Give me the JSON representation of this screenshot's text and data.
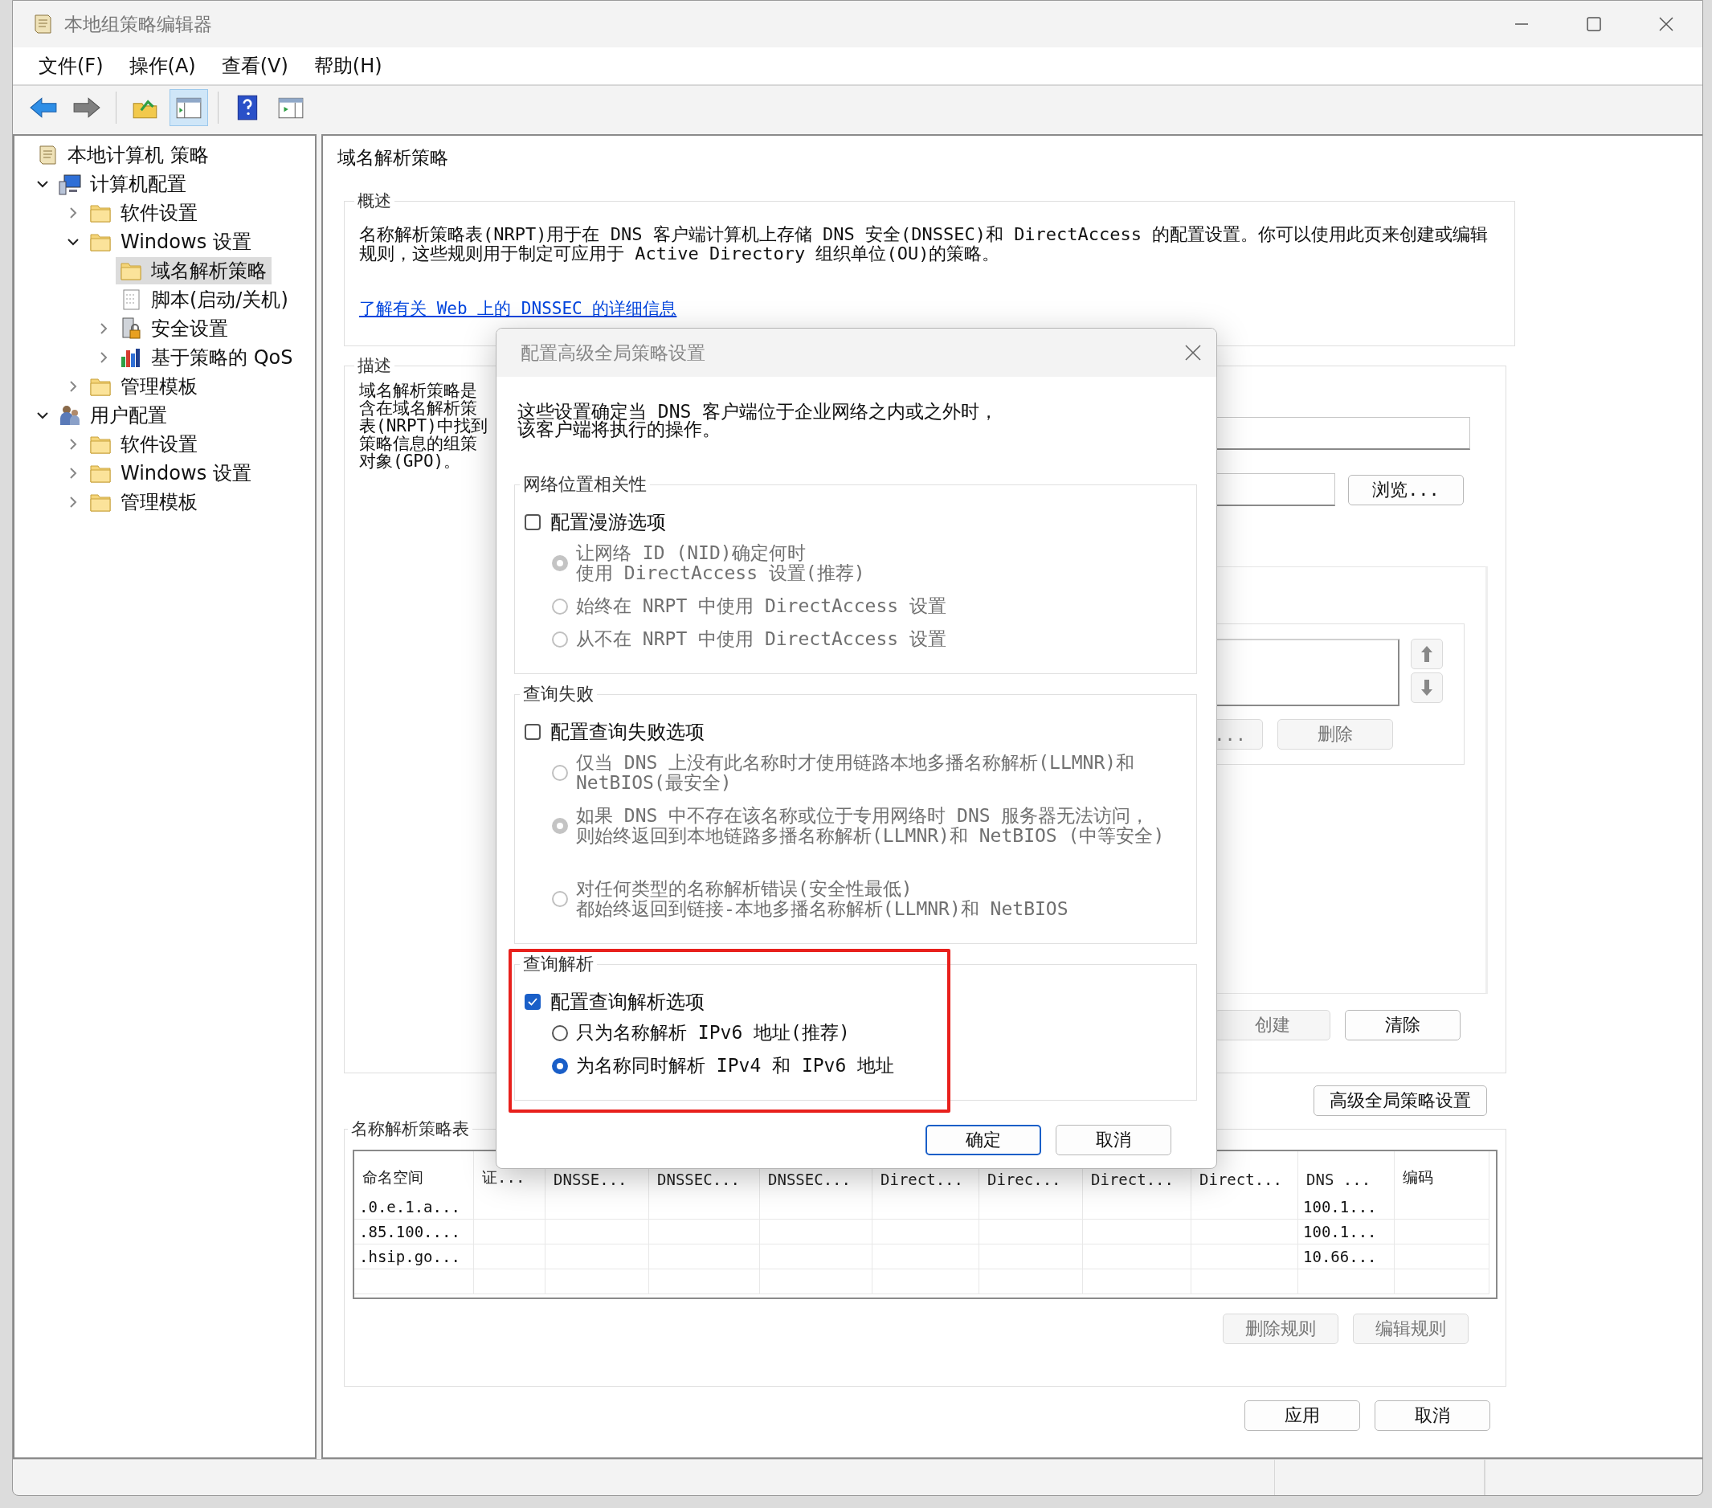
{
  "window": {
    "title": "本地组策略编辑器"
  },
  "menu": [
    "文件(F)",
    "操作(A)",
    "查看(V)",
    "帮助(H)"
  ],
  "toolbar": [
    {
      "kind": "back",
      "pressed": false
    },
    {
      "kind": "forward",
      "pressed": false
    },
    {
      "kind": "up",
      "pressed": false
    },
    {
      "kind": "tree",
      "pressed": true
    },
    {
      "kind": "help",
      "pressed": false
    },
    {
      "kind": "pane",
      "pressed": false
    }
  ],
  "tree": [
    {
      "label": "本地计算机 策略",
      "kind": "policy",
      "selected": false,
      "children": [
        {
          "label": "计算机配置",
          "kind": "computer",
          "selected": false,
          "expanded": true,
          "children": [
            {
              "label": "软件设置",
              "kind": "folder",
              "selected": false,
              "expanded": false
            },
            {
              "label": "Windows 设置",
              "kind": "folder",
              "selected": false,
              "expanded": true,
              "children": [
                {
                  "label": "域名解析策略",
                  "kind": "folder",
                  "selected": true
                },
                {
                  "label": "脚本(启动/关机)",
                  "kind": "script",
                  "selected": false
                },
                {
                  "label": "安全设置",
                  "kind": "security",
                  "selected": false,
                  "expanded": false
                },
                {
                  "label": "基于策略的 QoS",
                  "kind": "qos",
                  "selected": false,
                  "expanded": false
                }
              ]
            },
            {
              "label": "管理模板",
              "kind": "folder",
              "selected": false,
              "expanded": false
            }
          ]
        },
        {
          "label": "用户配置",
          "kind": "users",
          "selected": false,
          "expanded": true,
          "children": [
            {
              "label": "软件设置",
              "kind": "folder",
              "selected": false,
              "expanded": false
            },
            {
              "label": "Windows 设置",
              "kind": "folder",
              "selected": false,
              "expanded": false
            },
            {
              "label": "管理模板",
              "kind": "folder",
              "selected": false,
              "expanded": false
            }
          ]
        }
      ]
    }
  ],
  "page": {
    "title": "域名解析策略",
    "overview": {
      "title": "概述",
      "text": "名称解析策略表(NRPT)用于在 DNS 客户端计算机上存储 DNS 安全(DNSSEC)和 DirectAccess 的配置设置。你可以使用此页来创建或编辑规则，这些规则用于制定可应用于 Active Directory 组织单位(OU)的策略。",
      "link": "了解有关 Web 上的 DNSSEC 的详细信息"
    },
    "description": {
      "title": "描述",
      "lines": [
        "域名解析策略是",
        "含在域名解析策",
        "表(NRPT)中找到",
        "策略信息的组策",
        "对象(GPO)。"
      ],
      "browse_button": {
        "label": "浏览...",
        "disabled": false
      },
      "move_buttons": [
        {
          "kind": "up",
          "disabled": true
        },
        {
          "kind": "down",
          "disabled": true
        }
      ],
      "list_buttons": [
        {
          "label": "...",
          "disabled": true
        },
        {
          "label": "删除",
          "disabled": true
        }
      ],
      "rule_buttons": [
        {
          "label": "创建",
          "disabled": true
        },
        {
          "label": "清除",
          "disabled": false
        }
      ]
    },
    "advanced_button": {
      "label": "高级全局策略设置",
      "disabled": false
    },
    "table": {
      "title": "名称解析策略表",
      "columns": [
        "命名空间",
        "证...",
        "DNSSE...",
        "DNSSEC...",
        "DNSSEC...",
        "Direct...",
        "Direc...",
        "Direct...",
        "Direct...",
        "DNS ...",
        "编码"
      ],
      "rows": [
        {
          "column_1": ".0.e.1.a...",
          "column_10": "100.1..."
        },
        {
          "column_1": ".85.100....",
          "column_10": "100.1..."
        },
        {
          "column_1": ".hsip.go...",
          "column_10": "10.66..."
        }
      ]
    },
    "table_buttons": [
      {
        "label": "删除规则",
        "disabled": true
      },
      {
        "label": "编辑规则",
        "disabled": true
      }
    ],
    "footer_buttons": [
      {
        "label": "应用",
        "disabled": false
      },
      {
        "label": "取消",
        "disabled": false
      }
    ]
  },
  "dialog": {
    "title": "配置高级全局策略设置",
    "intro": [
      "这些设置确定当 DNS 客户端位于企业网络之内或之外时，",
      "该客户端将执行的操作。"
    ],
    "groups": [
      {
        "title": "网络位置相关性",
        "highlighted": false,
        "option": {
          "label": "配置漫游选项",
          "checked": false
        },
        "choices": [
          {
            "lines": [
              "让网络 ID (NID)确定何时",
              "使用 DirectAccess 设置(推荐)"
            ],
            "selected": true,
            "disabled": true
          },
          {
            "lines": [
              "始终在 NRPT 中使用 DirectAccess 设置"
            ],
            "selected": false,
            "disabled": true
          },
          {
            "lines": [
              "从不在 NRPT 中使用 DirectAccess 设置"
            ],
            "selected": false,
            "disabled": true
          }
        ]
      },
      {
        "title": "查询失败",
        "highlighted": false,
        "option": {
          "label": "配置查询失败选项",
          "checked": false
        },
        "choices": [
          {
            "lines": [
              "仅当 DNS 上没有此名称时才使用链路本地多播名称解析(LLMNR)和",
              "NetBIOS(最安全)"
            ],
            "selected": false,
            "disabled": true
          },
          {
            "lines": [
              "如果 DNS 中不存在该名称或位于专用网络时 DNS 服务器无法访问，",
              "则始终返回到本地链路多播名称解析(LLMNR)和 NetBIOS (中等安全)"
            ],
            "selected": true,
            "disabled": true
          },
          {
            "lines": [
              "对任何类型的名称解析错误(安全性最低)",
              "都始终返回到链接-本地多播名称解析(LLMNR)和 NetBIOS"
            ],
            "selected": false,
            "disabled": true
          }
        ]
      },
      {
        "title": "查询解析",
        "highlighted": true,
        "option": {
          "label": "配置查询解析选项",
          "checked": true
        },
        "choices": [
          {
            "lines": [
              "只为名称解析 IPv6 地址(推荐)"
            ],
            "selected": false,
            "disabled": false
          },
          {
            "lines": [
              "为名称同时解析 IPv4 和 IPv6 地址"
            ],
            "selected": true,
            "disabled": false
          }
        ]
      }
    ],
    "buttons": [
      {
        "label": "确定",
        "default": true
      },
      {
        "label": "取消",
        "default": false
      }
    ]
  }
}
